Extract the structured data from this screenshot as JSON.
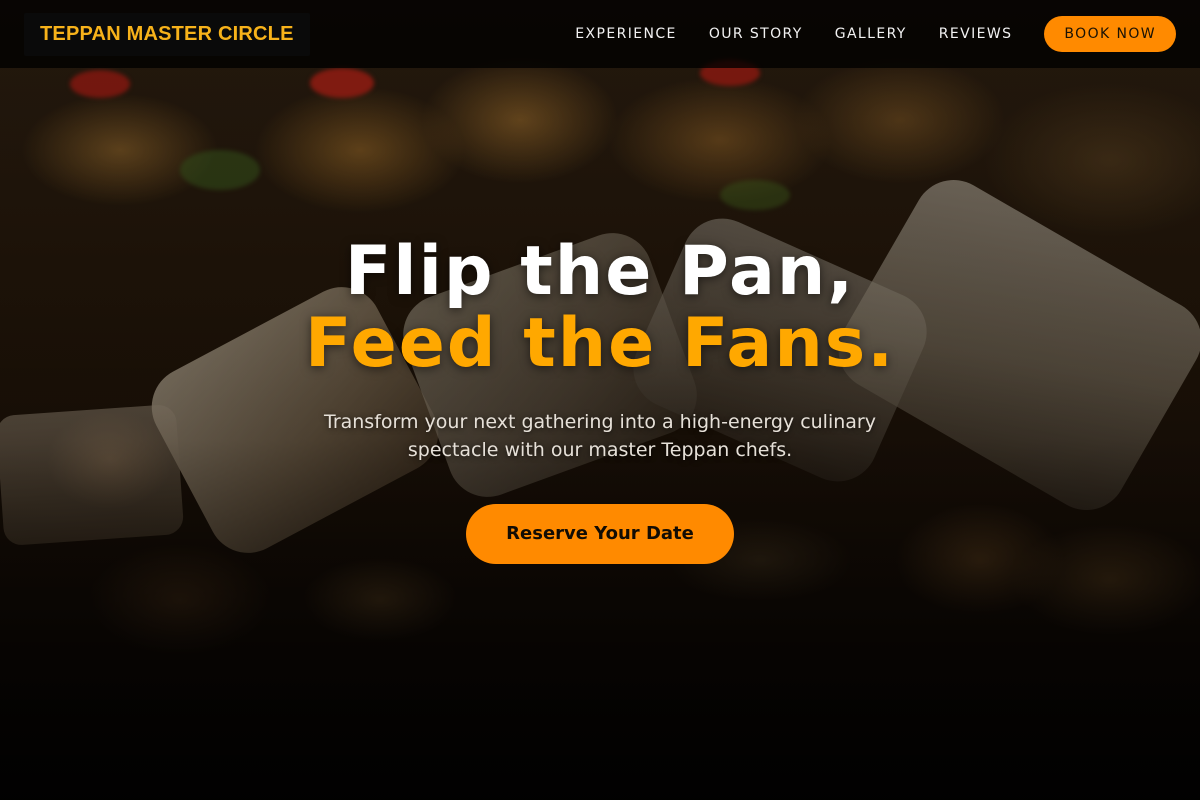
{
  "nav": {
    "logo": "TEPPAN MASTER CIRCLE",
    "links": [
      "EXPERIENCE",
      "OUR STORY",
      "GALLERY",
      "REVIEWS"
    ],
    "cta_label": "BOOK NOW"
  },
  "hero": {
    "headline_line1": "Flip the Pan,",
    "headline_line2": "Feed the Fans.",
    "subtitle": "Transform your next gathering into a high-energy culinary spectacle with our master Teppan chefs.",
    "cta_label": "Reserve Your Date",
    "background_image": "teppan-food-scene"
  },
  "colors": {
    "accent": "#ff8a00",
    "logo_gold": "#f7b21a",
    "headline_gold": "#ffa800",
    "nav_bg": "#000000"
  }
}
